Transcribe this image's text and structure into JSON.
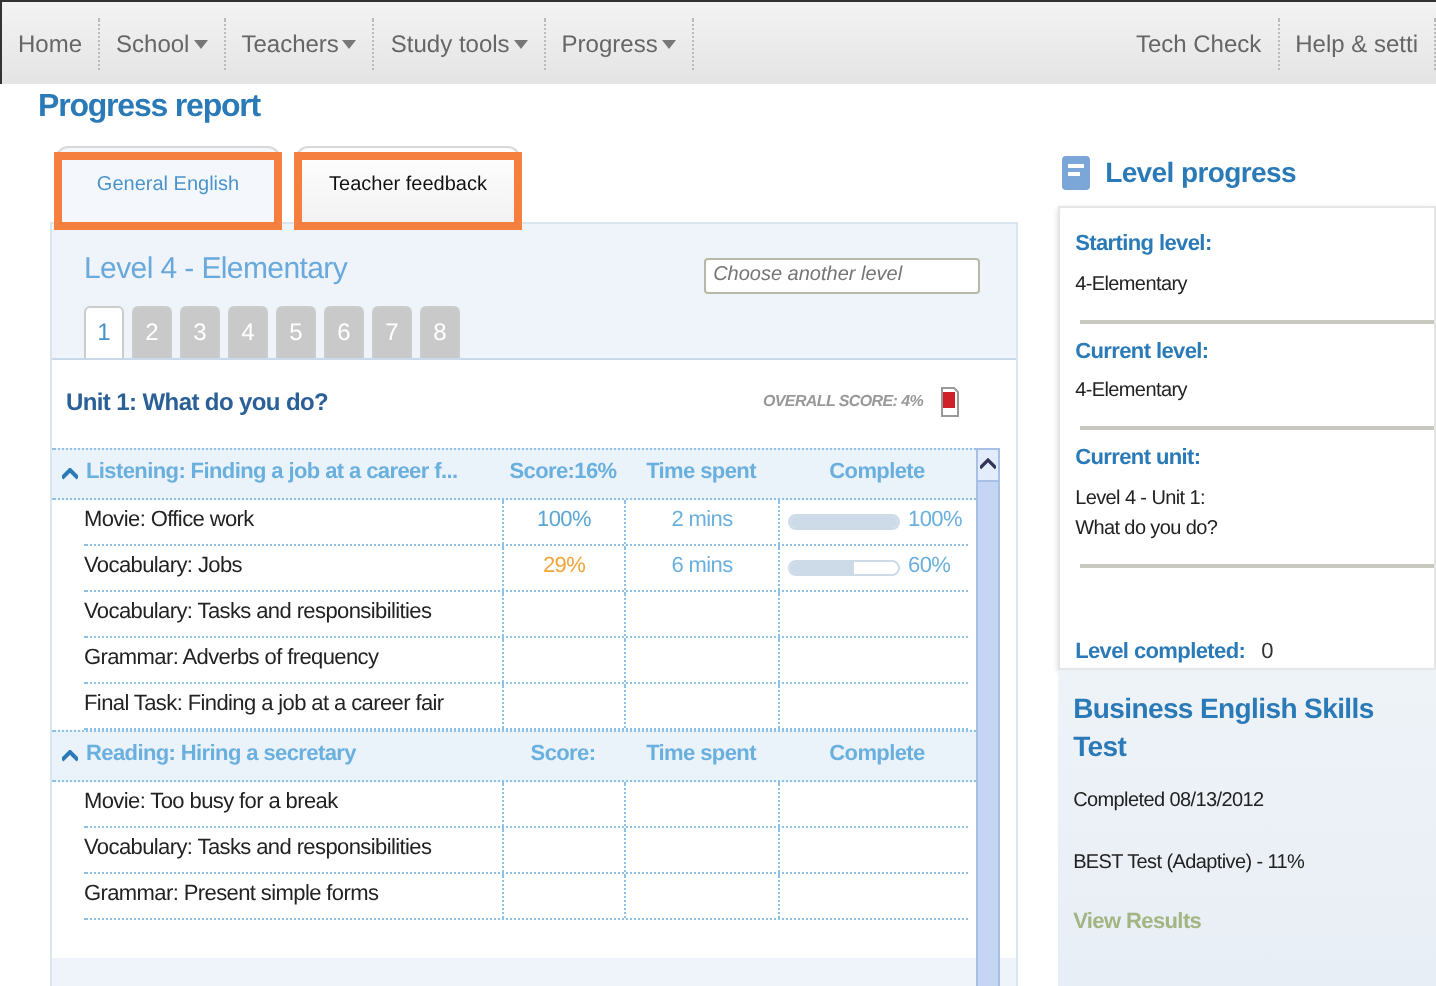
{
  "nav": {
    "left": [
      {
        "label": "Home",
        "dropdown": false
      },
      {
        "label": "School",
        "dropdown": true
      },
      {
        "label": "Teachers",
        "dropdown": true
      },
      {
        "label": "Study tools",
        "dropdown": true
      },
      {
        "label": "Progress",
        "dropdown": true
      }
    ],
    "right": [
      {
        "label": "Tech Check"
      },
      {
        "label": "Help & setti"
      }
    ]
  },
  "page_title": "Progress report",
  "tabs": [
    {
      "label": "General English",
      "selected": true,
      "highlighted": true
    },
    {
      "label": "Teacher feedback",
      "selected": false,
      "highlighted": true
    }
  ],
  "level_title": "Level 4 - Elementary",
  "level_select": {
    "placeholder": "Choose another level"
  },
  "level_tabs": [
    {
      "label": "1",
      "selected": true
    },
    {
      "label": "2",
      "selected": false
    },
    {
      "label": "3",
      "selected": false
    },
    {
      "label": "4",
      "selected": false
    },
    {
      "label": "5",
      "selected": false
    },
    {
      "label": "6",
      "selected": false
    },
    {
      "label": "7",
      "selected": false
    },
    {
      "label": "8",
      "selected": false
    }
  ],
  "unit": {
    "title": "Unit 1: What do you do?",
    "overall_score": "OVERALL SCORE: 4%"
  },
  "sections": [
    {
      "title": "Listening: Finding a job at a career f...",
      "score": "Score:16%",
      "time": "Time spent",
      "complete": "Complete",
      "expanded": true,
      "rows": [
        {
          "name": "Movie: Office work",
          "score": "100%",
          "color": "#5aa6d6",
          "time": "2 mins",
          "level": 1,
          "reading": "100%"
        },
        {
          "name": "Vocabulary: Jobs",
          "score": "29%",
          "color": "#f0a43a",
          "time": "6 mins",
          "level": 0.6,
          "reading": "60%"
        },
        {
          "name": "Vocabulary: Tasks and responsibilities"
        },
        {
          "name": "Grammar: Adverbs of frequency"
        },
        {
          "name": "Final Task: Finding a job at a career fair"
        }
      ]
    },
    {
      "title": "Reading: Hiring a secretary",
      "score": "Score:",
      "time": "Time spent",
      "complete": "Complete",
      "expanded": true,
      "rows": [
        {
          "name": "Movie: Too busy for a break"
        },
        {
          "name": "Vocabulary: Tasks and responsibilities"
        },
        {
          "name": "Grammar: Present simple forms"
        }
      ]
    }
  ],
  "level_progress": {
    "title": "Level progress",
    "fields": [
      {
        "label": "Starting level:",
        "value": "4-Elementary"
      },
      {
        "label": "Current level:",
        "value": "4-Elementary"
      },
      {
        "label": "Current unit:",
        "value": "Level 4 - Unit 1:\nWhat do you do?"
      }
    ],
    "completed": {
      "label": "Level completed:",
      "value": "0"
    }
  },
  "best": {
    "title": "Business English Skills Test",
    "completed": "Completed 08/13/2012",
    "result": "BEST Test (Adaptive) - 11%",
    "link": "View Results"
  }
}
